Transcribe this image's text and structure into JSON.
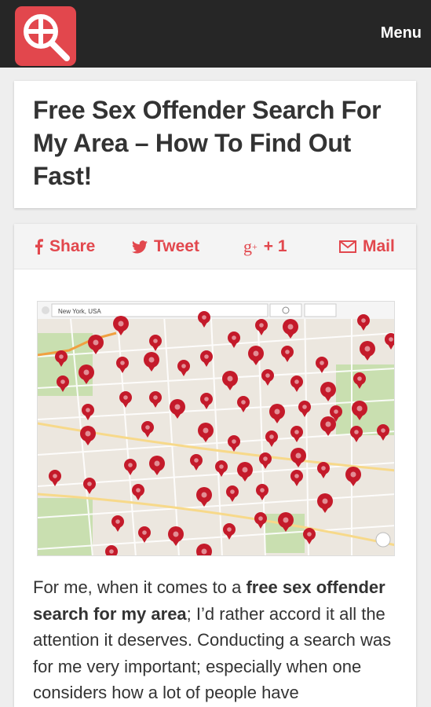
{
  "header": {
    "menu_label": "Menu",
    "logo_icon": "magnifier-icon",
    "accent_color": "#e2474d",
    "bar_color": "#262626"
  },
  "article": {
    "title": "Free Sex Offender Search For My Area – How To Find Out Fast!",
    "paragraph": {
      "intro": "For me, when it comes to a ",
      "bold": "free sex offender search for my area",
      "rest": "; I’d rather accord it all the attention it deserves. Conducting a search was for me very important; especially when one considers how a lot of people have"
    }
  },
  "share": {
    "facebook_label": "Share",
    "twitter_label": "Tweet",
    "gplus_label": "+ 1",
    "mail_label": "Mail"
  },
  "map": {
    "search_value": "New York, USA",
    "marker_color": "#c41a2a"
  }
}
